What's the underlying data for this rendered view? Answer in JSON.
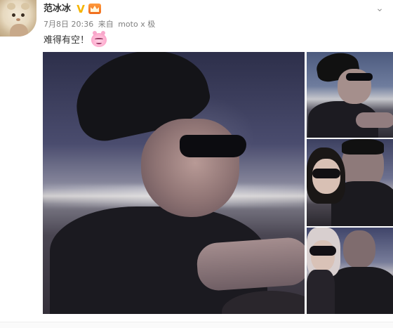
{
  "post": {
    "username": "范冰冰",
    "verified_icon": "verified-v-icon",
    "vip_icon": "vip-crown-icon",
    "menu_icon": "chevron-down-icon",
    "date": "7月8日 20:36",
    "source_prefix": "来自",
    "source": "moto x 极",
    "text": "难得有空！",
    "emoji_icon": "pink-bunny-emoji-icon",
    "accent_colors": {
      "verified": "#f5b400",
      "vip": "#f06b1b"
    }
  },
  "photos": [
    {
      "id": "main",
      "icon": "photo-thumbnail"
    },
    {
      "id": "s1",
      "icon": "photo-thumbnail"
    },
    {
      "id": "s2",
      "icon": "photo-thumbnail"
    },
    {
      "id": "s3",
      "icon": "photo-thumbnail"
    }
  ]
}
